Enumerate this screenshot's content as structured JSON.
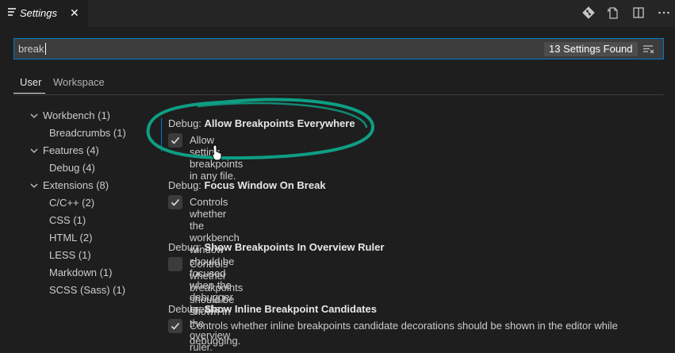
{
  "tab": {
    "title": "Settings",
    "close_glyph": "✕",
    "icon": "list-icon"
  },
  "actions": [
    "source-control-icon",
    "open-json-icon",
    "split-editor-icon",
    "more-actions-icon"
  ],
  "search": {
    "value": "break",
    "results_badge": "13 Settings Found",
    "clear_icon": "clear-filter-icon"
  },
  "scopes": {
    "user": "User",
    "workspace": "Workspace",
    "active": "User"
  },
  "tree": [
    {
      "label": "Workbench (1)",
      "expanded": true
    },
    {
      "label": "Breadcrumbs (1)"
    },
    {
      "label": "Features (4)",
      "expanded": true
    },
    {
      "label": "Debug (4)"
    },
    {
      "label": "Extensions (8)",
      "expanded": true
    },
    {
      "label": "C/C++ (2)"
    },
    {
      "label": "CSS (1)"
    },
    {
      "label": "HTML (2)"
    },
    {
      "label": "LESS (1)"
    },
    {
      "label": "Markdown (1)"
    },
    {
      "label": "SCSS (Sass) (1)"
    }
  ],
  "settings": [
    {
      "category": "Debug: ",
      "name": "Allow Breakpoints Everywhere",
      "checked": true,
      "description": "Allow setting breakpoints in any file."
    },
    {
      "category": "Debug: ",
      "name": "Focus Window On Break",
      "checked": true,
      "description": "Controls whether the workbench window should be focused when the debugger breaks."
    },
    {
      "category": "Debug: ",
      "name": "Show Breakpoints In Overview Ruler",
      "checked": false,
      "description": "Controls whether breakpoints should be shown in the overview ruler."
    },
    {
      "category": "Debug: ",
      "name": "Show Inline Breakpoint Candidates",
      "checked": true,
      "description": "Controls whether inline breakpoints candidate decorations should be shown in the editor while",
      "description_2": "debugging."
    }
  ],
  "colors": {
    "accent": "#007acc",
    "annotation": "#0e9e84",
    "background": "#1e1e1e"
  }
}
